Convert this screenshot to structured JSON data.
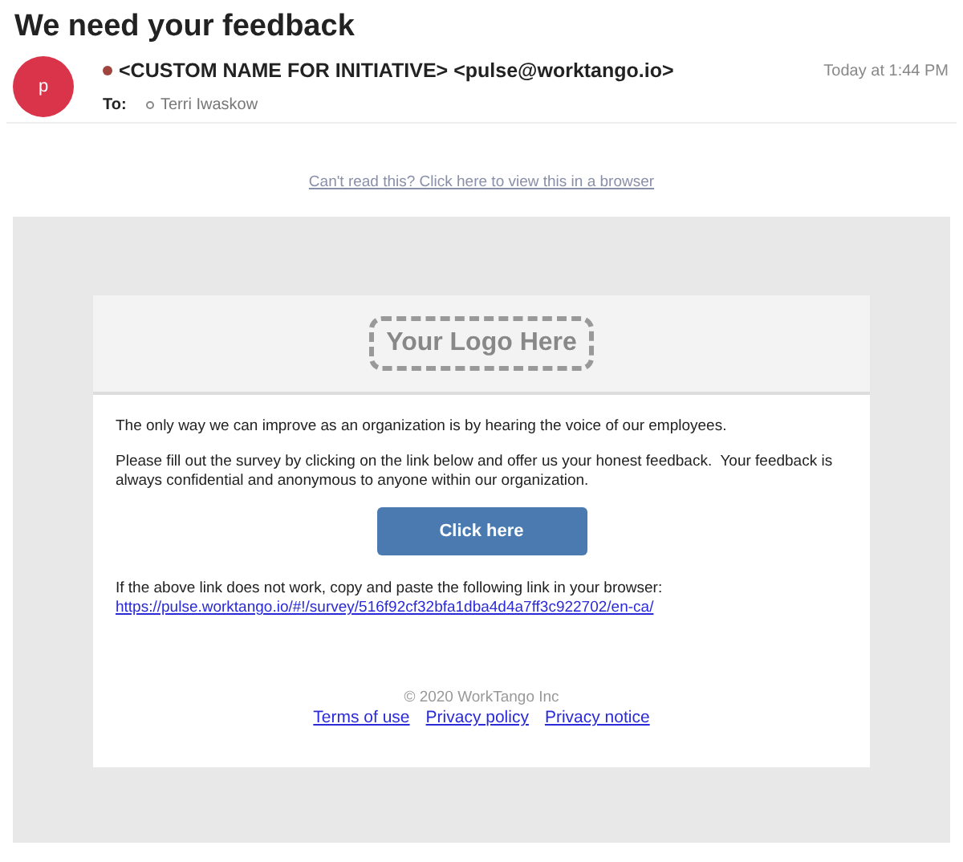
{
  "subject": "We need your feedback",
  "sender": {
    "avatar_letter": "p",
    "name": "<CUSTOM NAME FOR INITIATIVE> <pulse@worktango.io>",
    "time": "Today at 1:44 PM"
  },
  "to": {
    "label": "To:",
    "recipient": "Terri Iwaskow"
  },
  "browser_link": "Can't read this? Click here to view this in a browser",
  "logo": "Your Logo Here",
  "paragraphs": [
    "The only way we can improve as an organization is by hearing the voice of our employees.",
    "Please fill out the survey by clicking on the link below and offer us your honest feedback.  Your feedback is always confidential and anonymous to anyone within our organization."
  ],
  "button": "Click here",
  "fallback_text": "If the above link does not work, copy and paste the following link in your browser:",
  "fallback_link": "https://pulse.worktango.io/#!/survey/516f92cf32bfa1dba4d4a7ff3c922702/en-ca/",
  "copyright": "© 2020 WorkTango Inc",
  "footer_links": [
    "Terms of use",
    "Privacy policy",
    "Privacy notice"
  ]
}
